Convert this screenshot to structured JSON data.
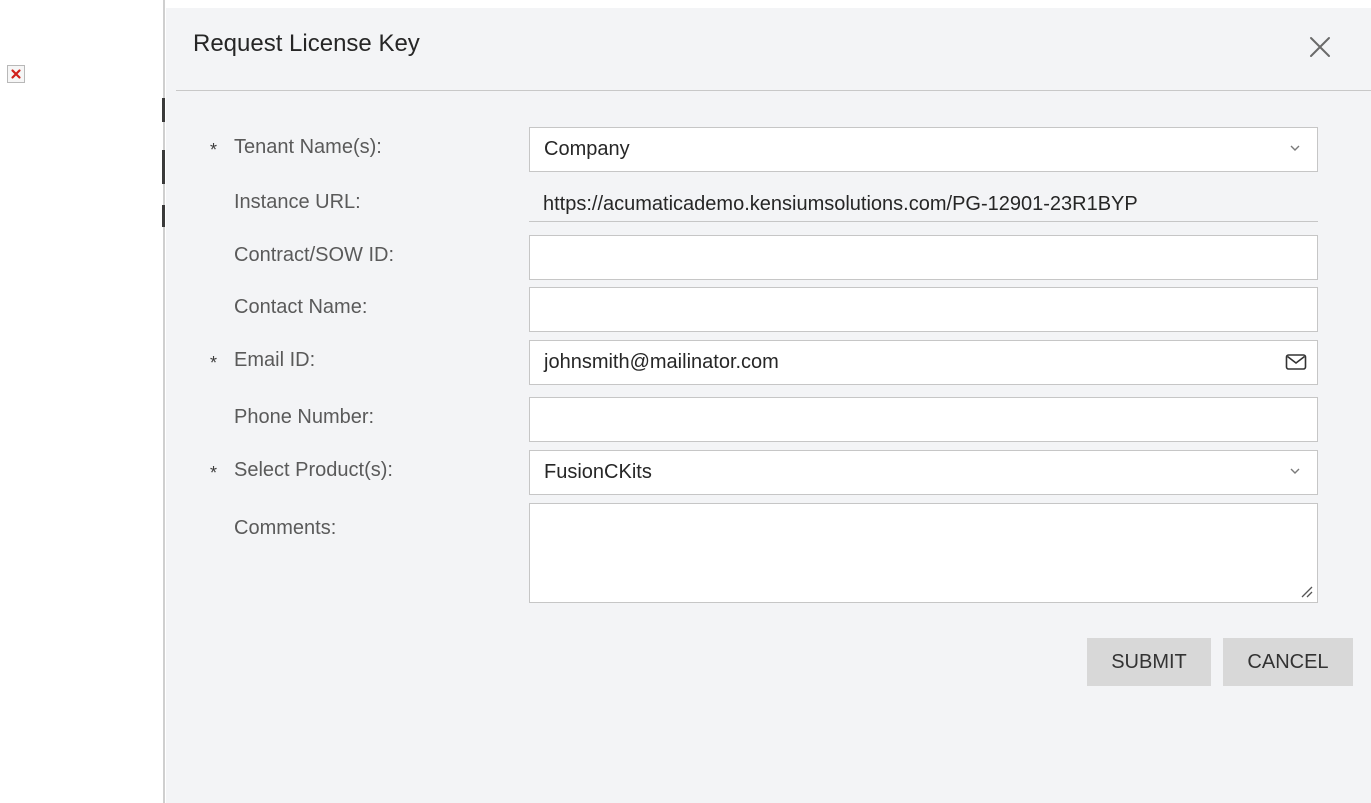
{
  "dialog": {
    "title": "Request License Key"
  },
  "form": {
    "tenant_name": {
      "label": "Tenant Name(s):",
      "required_mark": "*",
      "value": "Company"
    },
    "instance_url": {
      "label": "Instance URL:",
      "value": "https://acumaticademo.kensiumsolutions.com/PG-12901-23R1BYP"
    },
    "contract_id": {
      "label": "Contract/SOW ID:",
      "value": ""
    },
    "contact_name": {
      "label": "Contact Name:",
      "value": ""
    },
    "email": {
      "label": "Email ID:",
      "required_mark": "*",
      "value": "johnsmith@mailinator.com"
    },
    "phone": {
      "label": "Phone Number:",
      "value": ""
    },
    "product": {
      "label": "Select Product(s):",
      "required_mark": "*",
      "value": "FusionCKits"
    },
    "comments": {
      "label": "Comments:",
      "value": ""
    }
  },
  "buttons": {
    "submit": "SUBMIT",
    "cancel": "CANCEL"
  },
  "icons": {
    "close": "close-icon",
    "chevron": "chevron-down-icon",
    "mail": "mail-icon",
    "broken_image": "broken-image-icon",
    "resize": "resize-grip-icon"
  }
}
